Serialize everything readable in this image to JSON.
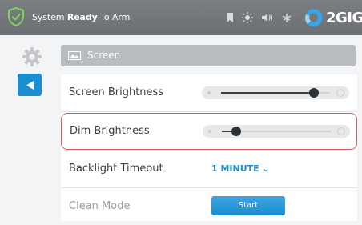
{
  "status_bar": {
    "status_prefix": "System",
    "status_ready": "Ready",
    "status_suffix": "To Arm",
    "brand": "2GIG",
    "icons": [
      "shield-check-icon",
      "bookmark-icon",
      "brightness-icon",
      "volume-icon",
      "wifi-icon"
    ]
  },
  "sidebar": {
    "icons": [
      "gear-icon",
      "back-arrow-icon"
    ]
  },
  "section": {
    "title": "Screen",
    "icon": "screen-icon"
  },
  "settings": {
    "screen_brightness": {
      "label": "Screen Brightness",
      "level": 0.85
    },
    "dim_brightness": {
      "label": "Dim Brightness",
      "level": 0.13
    },
    "backlight_timeout": {
      "label": "Backlight Timeout",
      "value": "1 MINUTE ⌄"
    },
    "clean_mode": {
      "label": "Clean Mode",
      "button": "Start"
    }
  },
  "colors": {
    "accent": "#1a8ed1",
    "selection_border": "#d95b5b",
    "header_bg": "#6c6f74"
  }
}
